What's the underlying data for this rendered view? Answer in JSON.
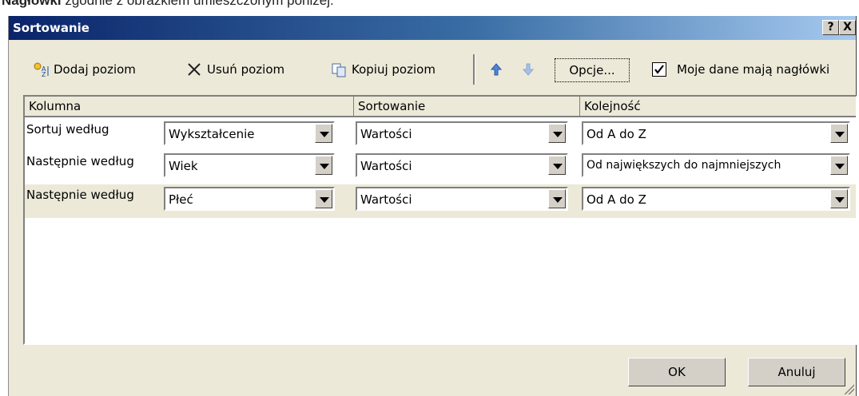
{
  "document": {
    "bold_text": "Nagłówki",
    "text": " zgodnie z obrazkiem umieszczonym poniżej."
  },
  "window": {
    "title": "Sortowanie",
    "help_button": "?",
    "close_button": "X"
  },
  "toolbar": {
    "add_level_label": "Dodaj poziom",
    "delete_level_label": "Usuń poziom",
    "copy_level_label": "Kopiuj poziom",
    "options_label": "Opcje...",
    "headers_checkbox_label": "Moje dane mają nagłówki",
    "headers_checked": true,
    "icons": [
      "add-level-icon",
      "delete-x-icon",
      "copy-icon",
      "move-up-arrow-icon",
      "move-down-arrow-icon"
    ]
  },
  "grid": {
    "headers": [
      "Kolumna",
      "Sortowanie",
      "Kolejność"
    ],
    "rows": [
      {
        "label": "Sortuj według",
        "column": "Wykształcenie",
        "sort_on": "Wartości",
        "order": "Od A do Z"
      },
      {
        "label": "Następnie według",
        "column": "Wiek",
        "sort_on": "Wartości",
        "order": "Od największych do najmniejszych"
      },
      {
        "label": "Następnie według",
        "column": "Płeć",
        "sort_on": "Wartości",
        "order": "Od A do Z"
      }
    ]
  },
  "footer": {
    "ok_label": "OK",
    "cancel_label": "Anuluj"
  },
  "colors": {
    "titlebar_start": "#0a246a",
    "titlebar_end": "#a6caf0",
    "dialog_bg": "#ece9d8",
    "selected_row_bg": "#ece9d8"
  }
}
